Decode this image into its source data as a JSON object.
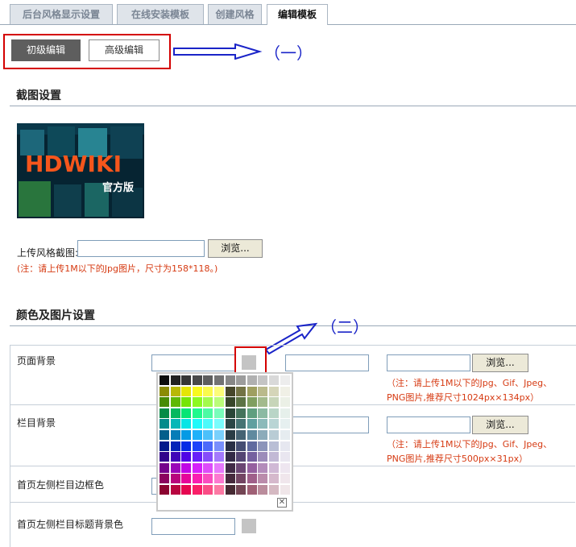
{
  "tabs": [
    {
      "label": "后台风格显示设置",
      "active": false
    },
    {
      "label": "在线安装模板",
      "active": false
    },
    {
      "label": "创建风格",
      "active": false
    },
    {
      "label": "编辑模板",
      "active": true
    }
  ],
  "editor": {
    "basic_label": "初级编辑",
    "advanced_label": "高级编辑"
  },
  "callouts": {
    "one": "（一）",
    "two": "（二）"
  },
  "screenshot_section": {
    "title": "截图设置",
    "thumbnail": {
      "brand": "HDWIKI",
      "edition": "官方版"
    },
    "upload_label": "上传风格截图:",
    "browse_label": "浏览...",
    "note": "(注：请上传1M以下的Jpg图片，尺寸为158*118。)"
  },
  "color_section": {
    "title": "颜色及图片设置",
    "rows": [
      {
        "label": "页面背景",
        "browse_label": "浏览...",
        "note_line1": "（注：请上传1M以下的Jpg、Gif、Jpeg、",
        "note_line2": "PNG图片,推荐尺寸1024px×134px）"
      },
      {
        "label": "栏目背景",
        "browse_label": "浏览...",
        "note_line1": "（注：请上传1M以下的Jpg、Gif、Jpeg、",
        "note_line2": "PNG图片,推荐尺寸500px×31px）"
      },
      {
        "label": "首页左侧栏目边框色"
      },
      {
        "label": "首页左侧栏目标题背景色"
      }
    ]
  },
  "picker": {
    "close_icon": "close-icon",
    "close_glyph": "✕"
  },
  "colors": {
    "accent_red": "#d40000",
    "callout_blue": "#1a24c8",
    "note_red": "#d63a12"
  }
}
